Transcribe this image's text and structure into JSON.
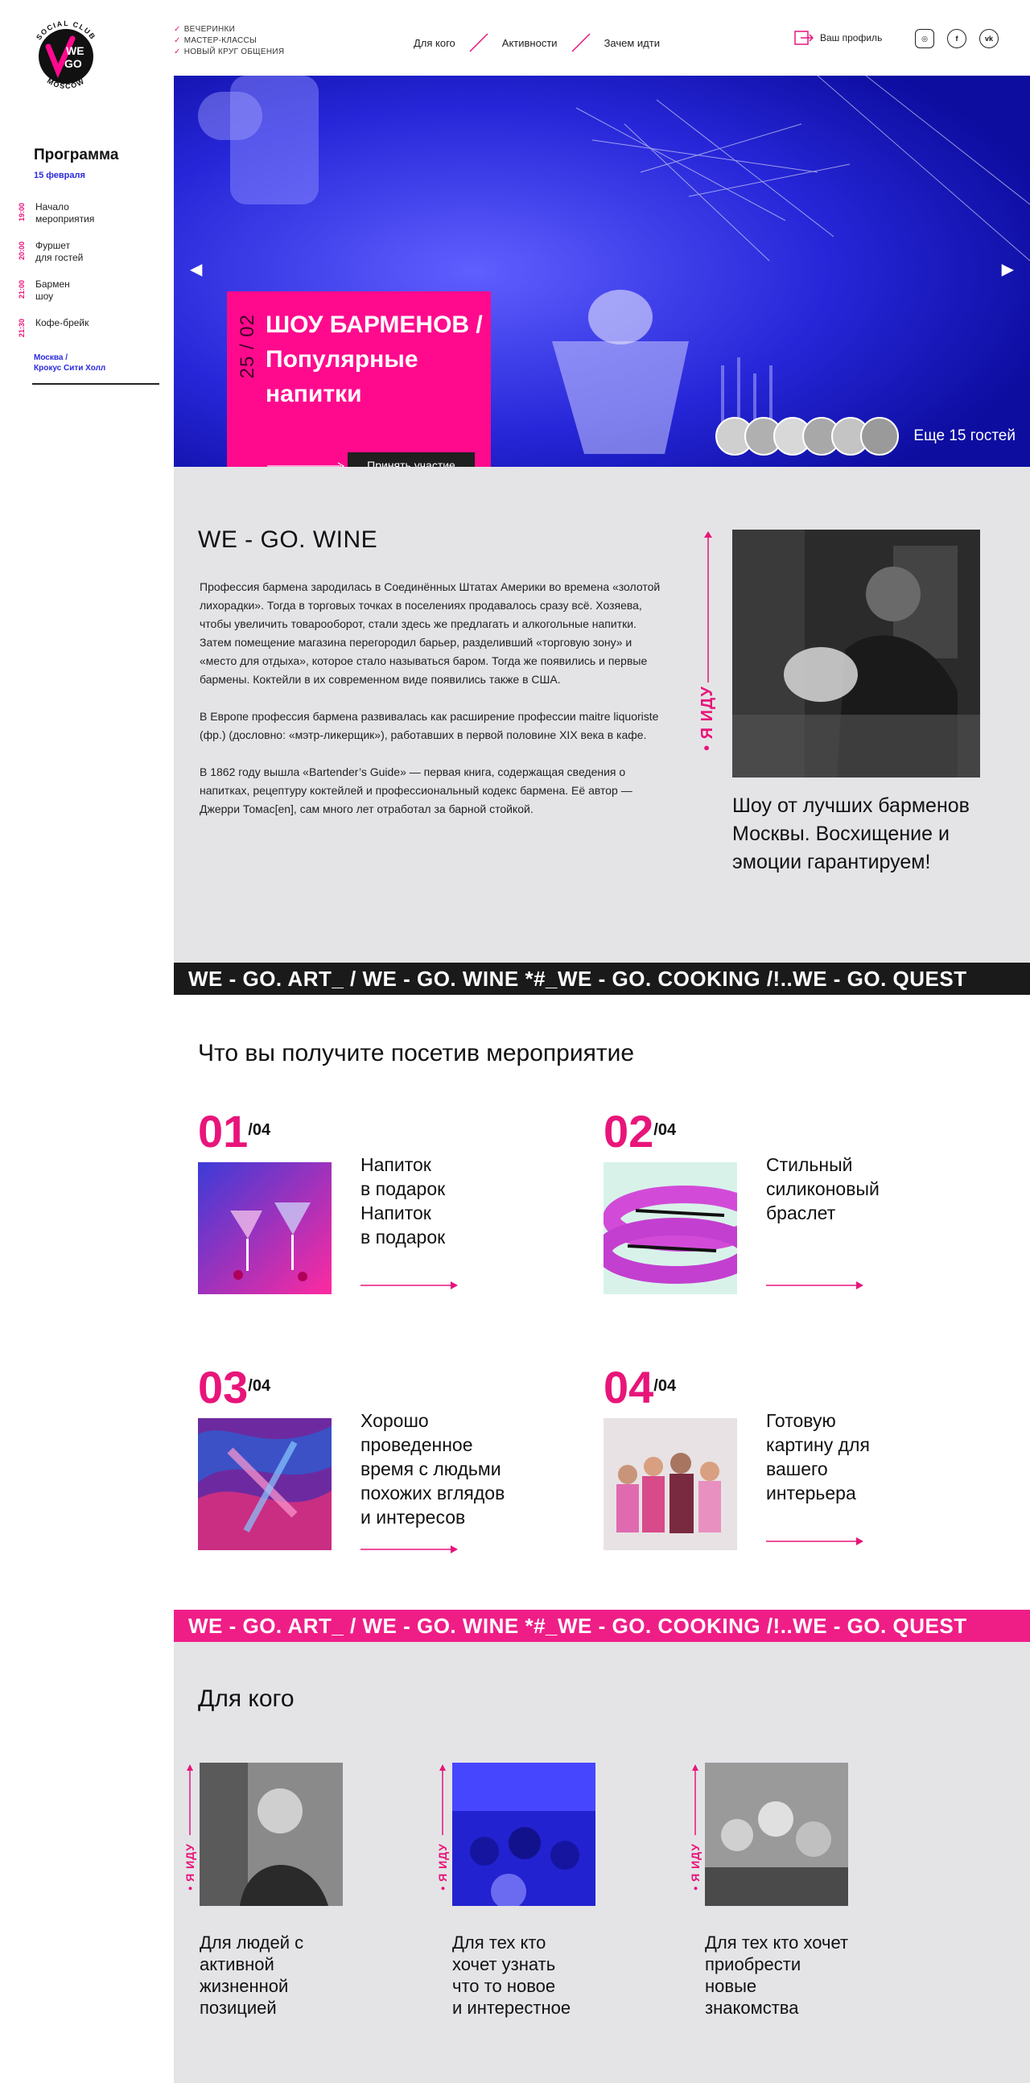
{
  "logo": {
    "top_text": "SOCIAL CLUB",
    "bottom_text": "MOSCOW",
    "we": "WE",
    "go": "GO"
  },
  "tagline": [
    "ВЕЧЕРИНКИ",
    "МАСТЕР-КЛАССЫ",
    "НОВЫЙ КРУГ ОБЩЕНИЯ"
  ],
  "nav": [
    "Для кого",
    "Активности",
    "Зачем идти"
  ],
  "profile_label": "Ваш профиль",
  "socials": [
    "instagram-icon",
    "facebook-icon",
    "vk-icon"
  ],
  "sidebar": {
    "title": "Программа",
    "date": "15 февраля",
    "schedule": [
      {
        "time": "19:00",
        "label": "Начало\nмероприятия"
      },
      {
        "time": "20:00",
        "label": "Фуршет\nдля гостей"
      },
      {
        "time": "21:00",
        "label": "Бармен\nшоу"
      },
      {
        "time": "21:30",
        "label": "Кофе-брейк"
      }
    ],
    "place": "Москва /\nКрокус Сити Холл"
  },
  "hero": {
    "date": "25 / 02",
    "title": "ШОУ БАРМЕНОВ / Популярные напитки",
    "button": "Принять участие",
    "guests_more": "Еще 15 гостей",
    "accent": "#ff0a8d"
  },
  "about": {
    "title": "WE - GO. WINE",
    "paragraphs": [
      "Профессия бармена зародилась в Соединённых Штатах Америки во времена «золотой лихорадки». Тогда в торговых точках в поселениях продавалось сразу всё. Хозяева, чтобы увеличить товарооборот, стали здесь же предлагать и алкогольные напитки. Затем помещение магазина перегородил барьер, разделивший «торговую зону» и «место для отдыха», которое стало называться баром. Тогда же появились и первые бармены. Коктейли в их современном виде появились также в США.",
      "В Европе профессия бармена развивалась как расширение профессии maitre liquoriste (фр.) (дословно: «мэтр-ликерщик»), работавших в первой половине XIX века в кафе.",
      "В 1862 году вышла «Bartender’s Guide» — первая книга, содержащая сведения о напитках, рецептуру коктейлей и профессиональный кодекс бармена. Её автор — Джерри Томас[en], сам много лет отработал за барной стойкой."
    ],
    "vertical_label": "• Я ИДУ",
    "quote": "Шоу от лучших барменов  Москвы. Восхищение и эмоции гарантируем!"
  },
  "ticker_text": "WE - GO. ART_ / WE - GO. WINE *#_WE - GO. COOKING /!..WE - GO. QUEST",
  "benefits": {
    "title": "Что вы получите посетив мероприятие",
    "total": "/04",
    "items": [
      {
        "num": "01",
        "text": "Напиток\nв подарок\nНапиток\nв подарок"
      },
      {
        "num": "02",
        "text": "Стильный\nсиликоновый\nбраслет"
      },
      {
        "num": "03",
        "text": "Хорошо\nпроведенное\nвремя  с людьми\nпохожих вглядов\nи интересов"
      },
      {
        "num": "04",
        "text": "Готовую\nкартину для\nвашего\nинтерьера"
      }
    ]
  },
  "forwhom": {
    "title": "Для кого",
    "vertical_label": "• Я ИДУ",
    "items": [
      {
        "text": "Для людей с\nактивной\nжизненной\nпозицией"
      },
      {
        "text": "Для тех кто\nхочет узнать\nчто то новое\nи интерестное"
      },
      {
        "text": "Для тех кто хочет\nприобрести\nновые\nзнакомства"
      }
    ]
  }
}
